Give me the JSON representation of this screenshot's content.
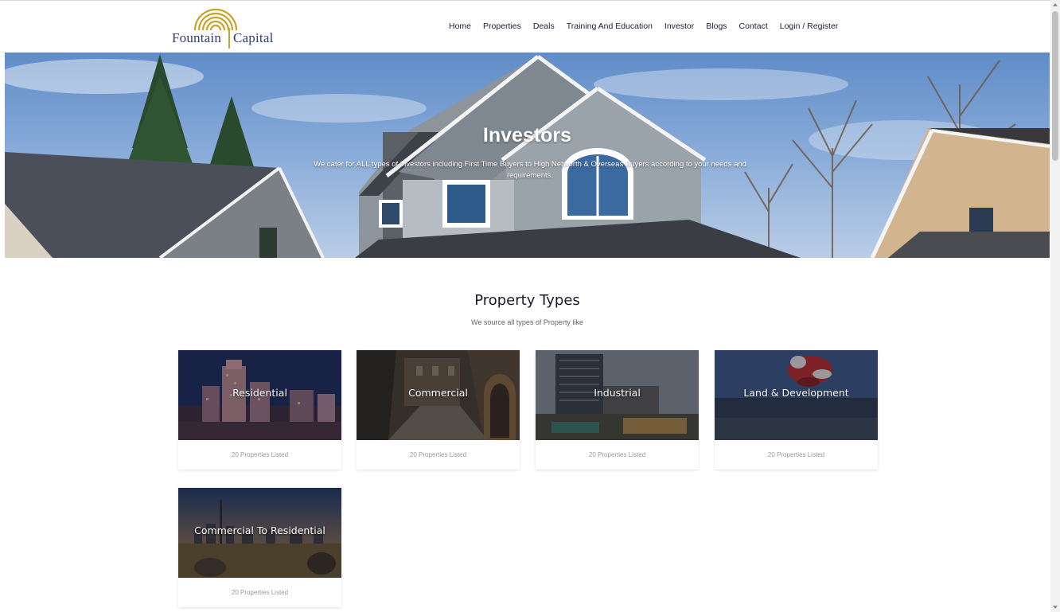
{
  "brand": {
    "name_left": "Fountain",
    "name_right": "Capital",
    "gold": "#c9a227",
    "navy": "#2f3d78"
  },
  "nav": {
    "items": [
      {
        "label": "Home"
      },
      {
        "label": "Properties"
      },
      {
        "label": "Deals"
      },
      {
        "label": "Training And Education"
      },
      {
        "label": "Investor"
      },
      {
        "label": "Blogs"
      },
      {
        "label": "Contact"
      },
      {
        "label": "Login / Register"
      }
    ]
  },
  "hero": {
    "title": "Investors",
    "subtitle": "We cater for ALL types of investors including First Time Buyers to High Networth & Overseas Buyers according to your needs and requirements."
  },
  "section": {
    "title": "Property Types",
    "subtitle": "We source all types of Property like"
  },
  "cards": [
    {
      "label": "Residential",
      "count": "20 Properties Listed"
    },
    {
      "label": "Commercial",
      "count": "20 Properties Listed"
    },
    {
      "label": "Industrial",
      "count": "20 Properties Listed"
    },
    {
      "label": "Land & Development",
      "count": "20 Properties Listed"
    },
    {
      "label": "Commercial To Residential",
      "count": "20 Properties Listed"
    }
  ]
}
